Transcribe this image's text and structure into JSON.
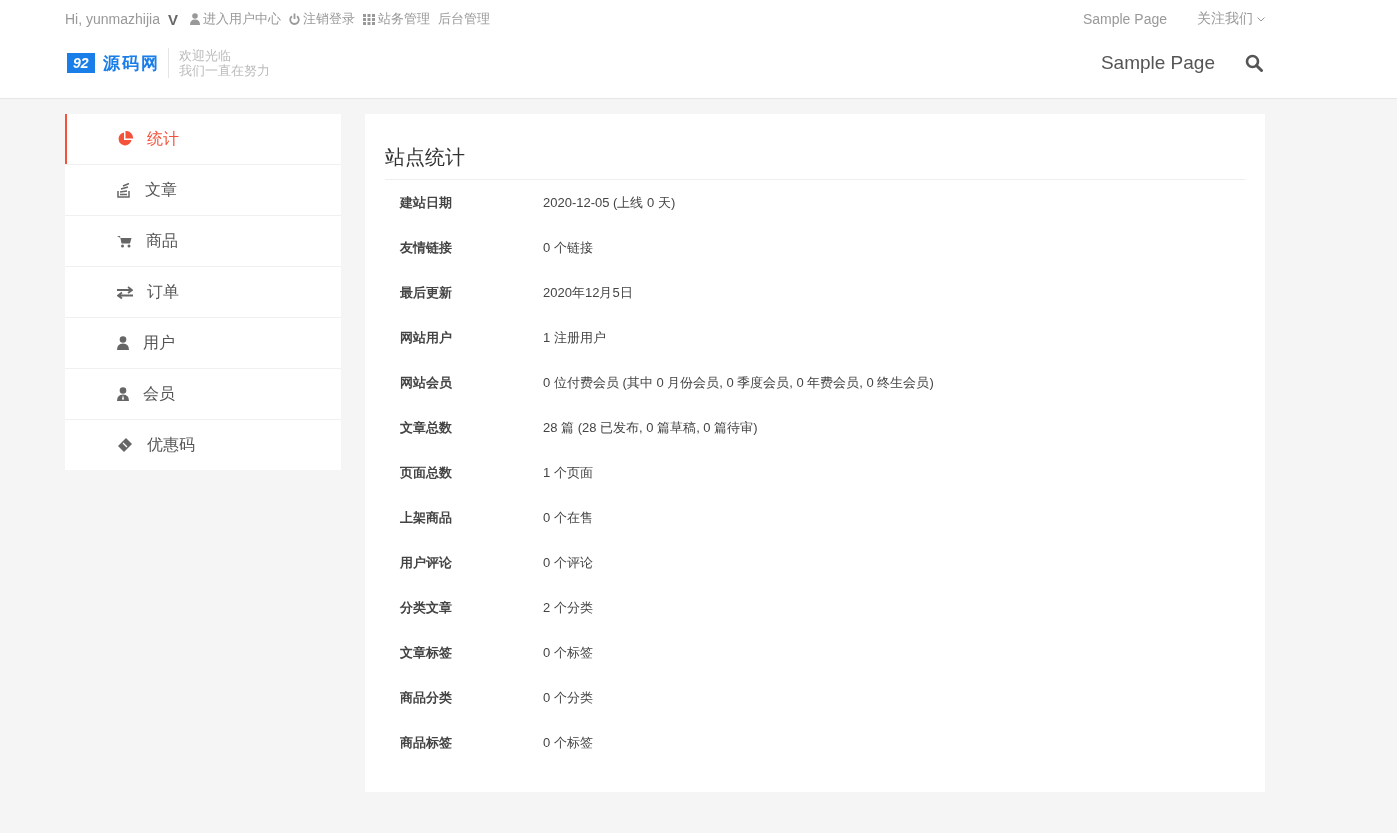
{
  "topbar": {
    "greeting": "Hi, yunmazhijia",
    "badge": "V",
    "links": [
      {
        "kind": "user",
        "label": "进入用户中心"
      },
      {
        "kind": "power",
        "label": "注销登录"
      },
      {
        "kind": "grid",
        "label": "站务管理"
      },
      {
        "kind": "none",
        "label": "后台管理"
      }
    ],
    "right_links": [
      {
        "label": "Sample Page",
        "dropdown": false
      },
      {
        "label": "关注我们",
        "dropdown": true
      }
    ]
  },
  "logo": {
    "number": "92",
    "name": "源码网",
    "tagline_1": "欢迎光临",
    "tagline_2": "我们一直在努力"
  },
  "nav": {
    "items": [
      "Sample Page"
    ]
  },
  "sidebar": {
    "items": [
      {
        "kind": "chart",
        "label": "统计",
        "selected": true
      },
      {
        "kind": "article",
        "label": "文章",
        "selected": false
      },
      {
        "kind": "cart",
        "label": "商品",
        "selected": false
      },
      {
        "kind": "exchange",
        "label": "订单",
        "selected": false
      },
      {
        "kind": "user",
        "label": "用户",
        "selected": false
      },
      {
        "kind": "member",
        "label": "会员",
        "selected": false
      },
      {
        "kind": "ticket",
        "label": "优惠码",
        "selected": false
      }
    ]
  },
  "panel": {
    "title": "站点统计",
    "rows": [
      {
        "label": "建站日期",
        "value": "2020-12-05 (上线 0 天)"
      },
      {
        "label": "友情链接",
        "value": "0 个链接"
      },
      {
        "label": "最后更新",
        "value": "2020年12月5日"
      },
      {
        "label": "网站用户",
        "value": "1 注册用户"
      },
      {
        "label": "网站会员",
        "value": "0 位付费会员 (其中 0 月份会员, 0 季度会员, 0 年费会员, 0 终生会员)"
      },
      {
        "label": "文章总数",
        "value": "28 篇 (28 已发布, 0 篇草稿, 0 篇待审)"
      },
      {
        "label": "页面总数",
        "value": "1 个页面"
      },
      {
        "label": "上架商品",
        "value": "0 个在售"
      },
      {
        "label": "用户评论",
        "value": "0 个评论"
      },
      {
        "label": "分类文章",
        "value": "2 个分类"
      },
      {
        "label": "文章标签",
        "value": "0 个标签"
      },
      {
        "label": "商品分类",
        "value": "0 个分类"
      },
      {
        "label": "商品标签",
        "value": "0 个标签"
      }
    ]
  }
}
